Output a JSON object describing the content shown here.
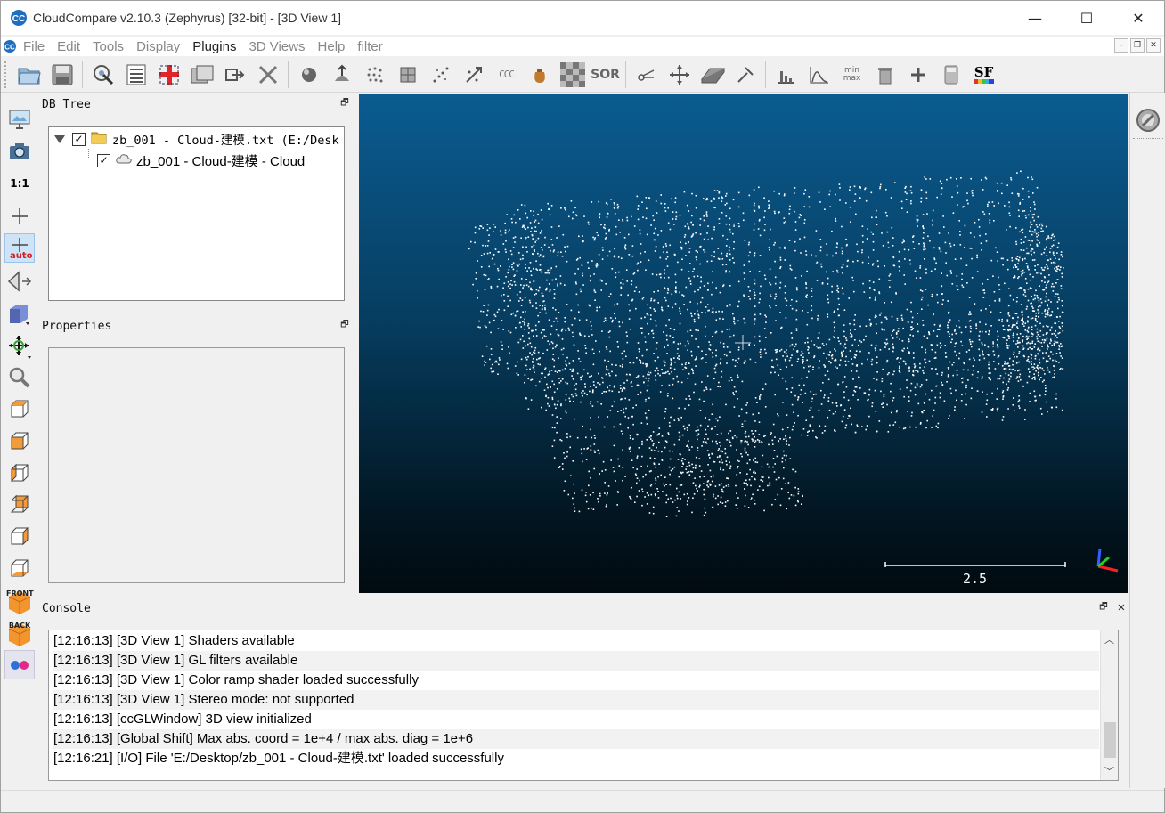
{
  "window": {
    "title": "CloudCompare v2.10.3 (Zephyrus) [32-bit] - [3D View 1]",
    "controls": {
      "minimize": "—",
      "maximize": "☐",
      "close": "✕"
    }
  },
  "menubar": {
    "items": [
      {
        "label": "File",
        "enabled": false
      },
      {
        "label": "Edit",
        "enabled": false
      },
      {
        "label": "Tools",
        "enabled": false
      },
      {
        "label": "Display",
        "enabled": false
      },
      {
        "label": "Plugins",
        "enabled": true
      },
      {
        "label": "3D Views",
        "enabled": false
      },
      {
        "label": "Help",
        "enabled": false
      },
      {
        "label": "filter",
        "enabled": false
      }
    ],
    "mdi": {
      "minimize": "–",
      "restore": "❐",
      "close": "✕"
    }
  },
  "toolbar": {
    "ccc_label": "CCC",
    "sor_label": "SOR",
    "minmax_label": "min max",
    "sf_label": "SF"
  },
  "lefttoolbar": {
    "one_to_one_label": "1:1",
    "auto_label": "auto",
    "front_label": "FRONT",
    "back_label": "BACK"
  },
  "dbtree": {
    "title": "DB Tree",
    "float_icon": "🗗",
    "root": {
      "label": "zb_001 - Cloud-建模.txt (E:/Desk",
      "checked": true
    },
    "child": {
      "label": "zb_001 - Cloud-建模 - Cloud",
      "checked": true
    }
  },
  "properties": {
    "title": "Properties",
    "float_icon": "🗗"
  },
  "view3d": {
    "scale_label": "2.5",
    "colors": {
      "top": "#0b5c91",
      "bottom": "#010a10"
    }
  },
  "console": {
    "title": "Console",
    "float_icon": "🗗",
    "close_icon": "✕",
    "lines": [
      "[12:16:13] [3D View 1] Shaders available",
      "[12:16:13] [3D View 1] GL filters available",
      "[12:16:13] [3D View 1] Color ramp shader loaded successfully",
      "[12:16:13] [3D View 1] Stereo mode: not supported",
      "[12:16:13] [ccGLWindow] 3D view initialized",
      "[12:16:13] [Global Shift] Max abs. coord = 1e+4 / max abs. diag = 1e+6",
      "[12:16:21] [I/O] File 'E:/Desktop/zb_001 - Cloud-建模.txt' loaded successfully"
    ],
    "scroll_up": "︿",
    "scroll_down": "﹀"
  }
}
